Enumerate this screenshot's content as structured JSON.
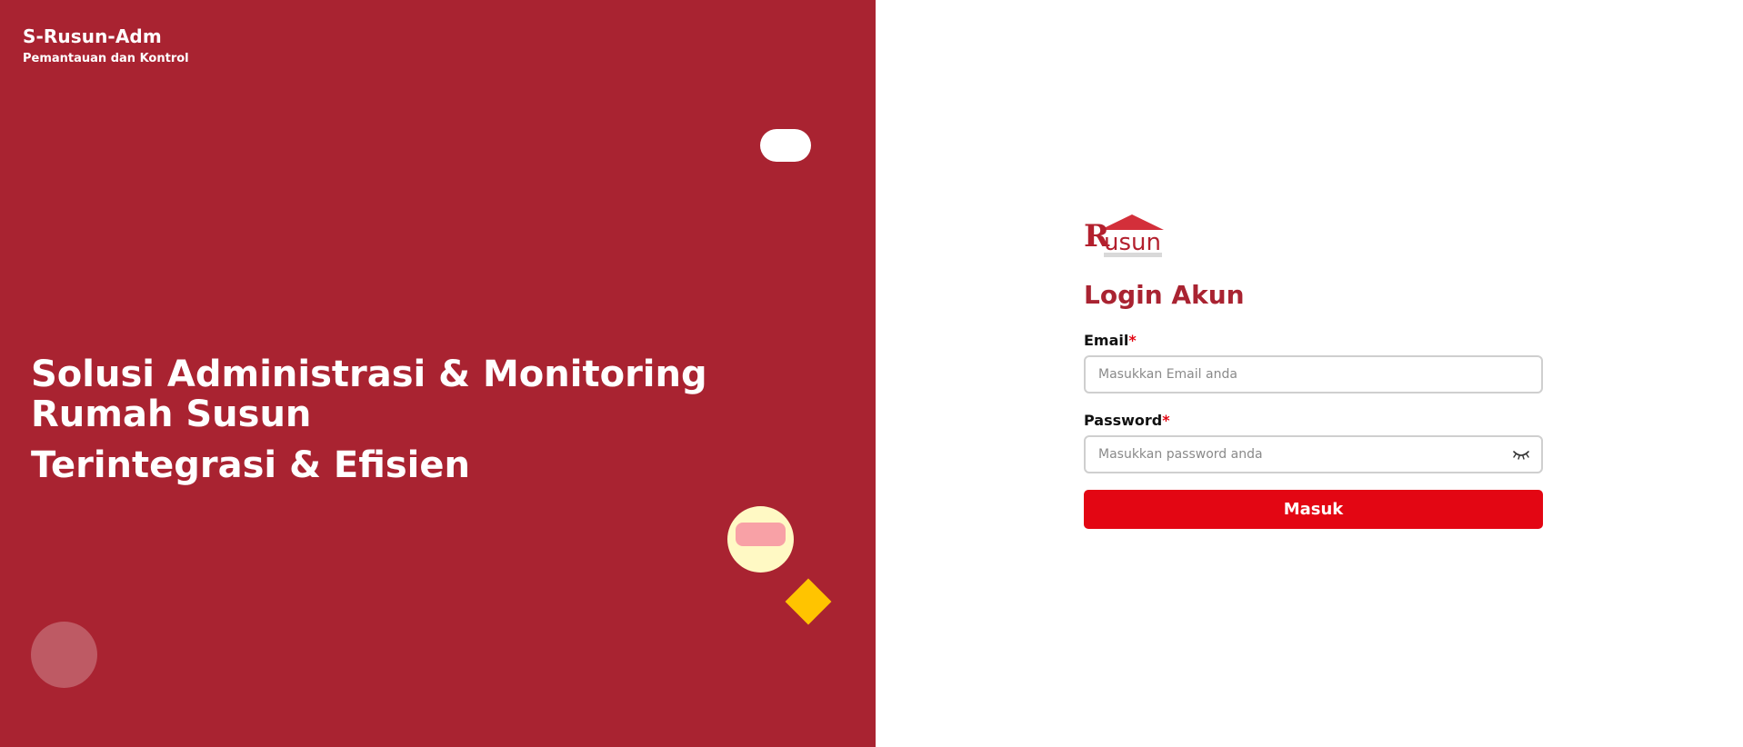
{
  "brand": {
    "title": "S-Rusun-Adm",
    "subtitle": "Pemantauan dan Kontrol"
  },
  "hero": {
    "line1": "Solusi Administrasi & Monitoring Rumah Susun",
    "line2": "Terintegrasi & Efisien"
  },
  "logo": {
    "text_prefix": "R",
    "text_rest": "usun"
  },
  "form": {
    "title": "Login Akun",
    "email_label": "Email",
    "email_required": "*",
    "email_placeholder": "Masukkan Email anda",
    "password_label": "Password",
    "password_required": "*",
    "password_placeholder": "Masukkan password anda",
    "password_toggle_icon": "eye-closed-icon",
    "submit_label": "Masuk"
  },
  "colors": {
    "left_panel": "#a92331",
    "title": "#a92331",
    "button": "#e30613",
    "required": "#e30613",
    "accent_yellow": "#ffc400"
  }
}
